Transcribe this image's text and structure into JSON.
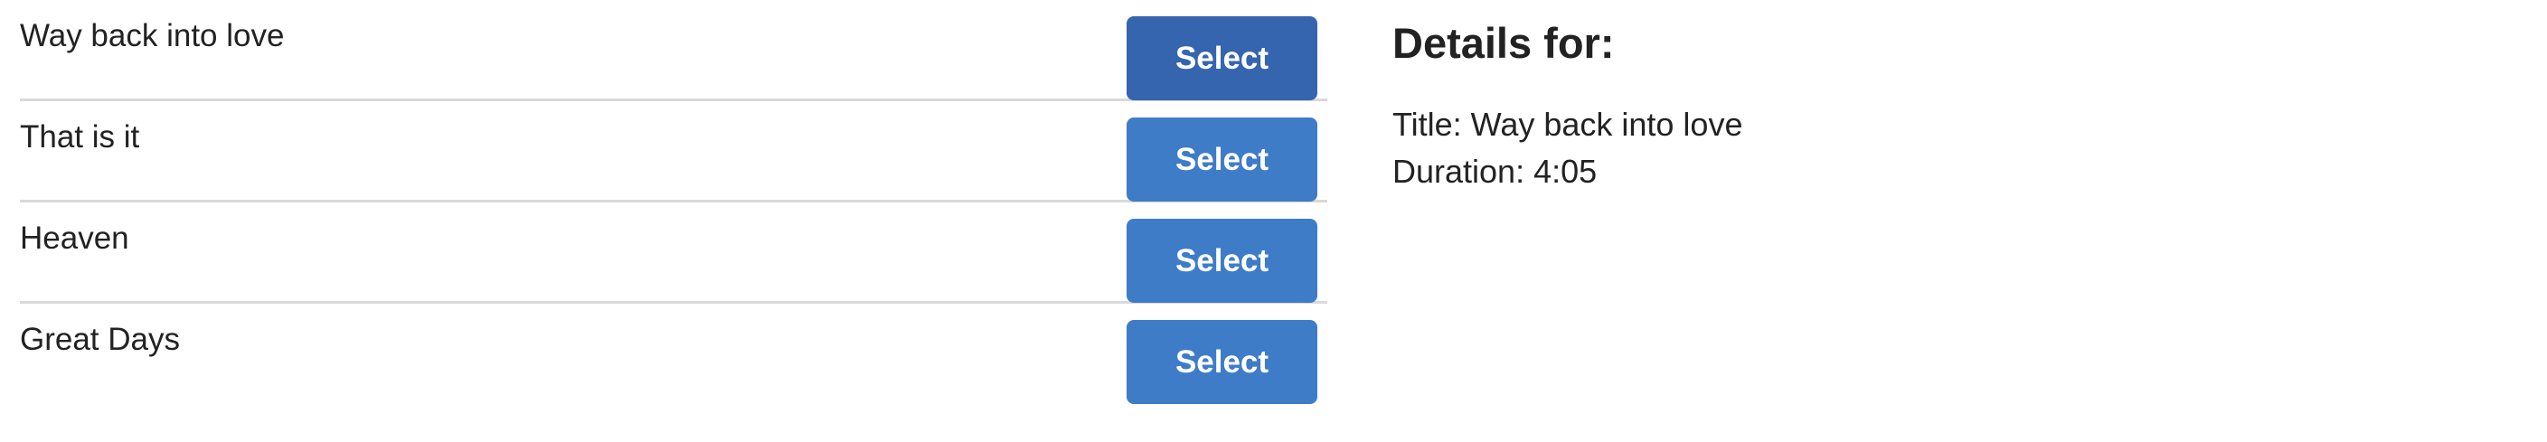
{
  "songs": [
    {
      "title": "Way back into love",
      "button_label": "Select",
      "selected": true
    },
    {
      "title": "That is it",
      "button_label": "Select",
      "selected": false
    },
    {
      "title": "Heaven",
      "button_label": "Select",
      "selected": false
    },
    {
      "title": "Great Days",
      "button_label": "Select",
      "selected": false
    }
  ],
  "details": {
    "heading": "Details for:",
    "title_line": "Title: Way back into love",
    "duration_line": "Duration: 4:05"
  },
  "colors": {
    "button": "#3f7cc8",
    "button_active": "#3565ae",
    "divider": "#d9d9d9"
  }
}
